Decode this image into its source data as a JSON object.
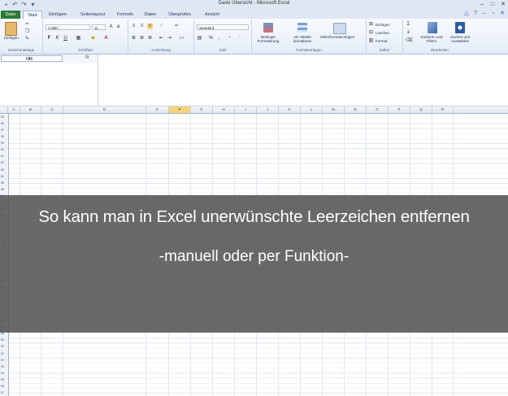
{
  "window": {
    "title": "Daski Übersicht  -  Microsoft Excel",
    "controls": [
      "–",
      "□",
      "✕"
    ]
  },
  "qat": [
    "save-icon",
    "undo-icon",
    "redo-icon",
    "customize-icon"
  ],
  "tabs": [
    "Datei",
    "Start",
    "Einfügen",
    "Seitenlayout",
    "Formeln",
    "Daten",
    "Überprüfen",
    "Ansicht"
  ],
  "ribbon": {
    "clipboard": {
      "label": "Zwischenablage",
      "paste": "Einfügen"
    },
    "font": {
      "label": "Schriftart",
      "name": "Calibri",
      "size": "11",
      "bold": "F",
      "italic": "K",
      "underline": "U"
    },
    "alignment": {
      "label": "Ausrichtung"
    },
    "number": {
      "label": "Zahl",
      "format": "Standard"
    },
    "styles": {
      "label": "Formatvorlagen",
      "conditional": "Bedingte Formatierung",
      "table": "Als Tabelle formatieren",
      "cellstyles": "Zellenformatvorlagen"
    },
    "cells": {
      "label": "Zellen",
      "insert": "Einfügen",
      "delete": "Löschen",
      "format": "Format"
    },
    "editing": {
      "label": "Bearbeiten",
      "sort": "Sortieren und Filtern",
      "find": "Suchen und Auswählen"
    }
  },
  "formula_bar": {
    "name_box": "F26",
    "fx": "fx",
    "content": ""
  },
  "columns": [
    "A",
    "B",
    "C",
    "D",
    "E",
    "F",
    "G",
    "H",
    "I",
    "J",
    "K",
    "L",
    "M",
    "N",
    "O",
    "P",
    "Q",
    "R"
  ],
  "selected_column": "F",
  "rows": [
    "55",
    "56",
    "57",
    "58",
    "59",
    "60",
    "61",
    "62",
    "63",
    "64",
    "65",
    "66",
    "67",
    "68",
    "69",
    "70",
    "71",
    "72",
    "73",
    "74",
    "75",
    "76",
    "77",
    "78",
    "79",
    "80",
    "81",
    "82",
    "83",
    "84",
    "85",
    "86",
    "87",
    "88",
    "89",
    "90",
    "91",
    "92",
    "93",
    "94",
    "95",
    "96",
    "97"
  ],
  "overlay": {
    "headline": "So kann man in Excel unerwünschte Leerzeichen entfernen",
    "subline": "-manuell oder per Funktion-"
  }
}
